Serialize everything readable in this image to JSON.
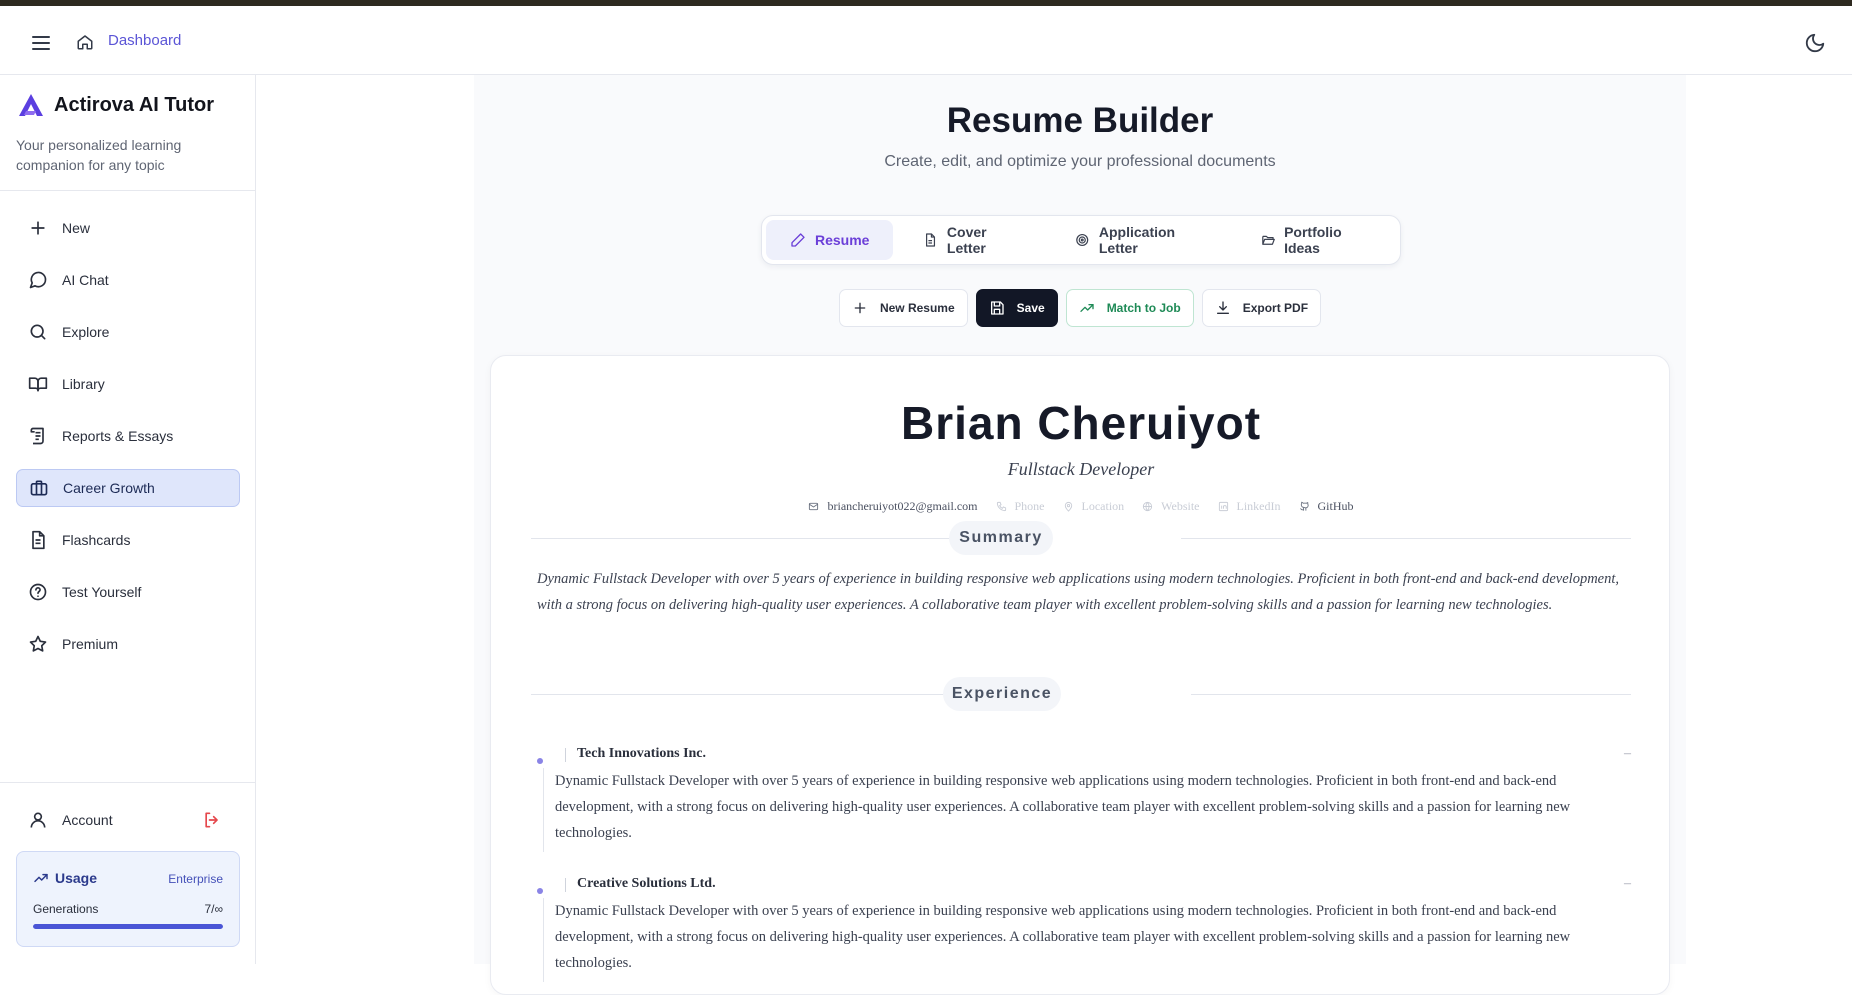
{
  "topbar": {
    "breadcrumb": "Dashboard"
  },
  "brand": {
    "title": "Actirova AI Tutor",
    "subtitle": "Your personalized learning companion for any topic",
    "accent": "#5b3fe0"
  },
  "sidebar": {
    "items": [
      {
        "label": "New",
        "icon": "plus-icon",
        "active": false
      },
      {
        "label": "AI Chat",
        "icon": "chat-bubble-icon",
        "active": false
      },
      {
        "label": "Explore",
        "icon": "search-icon",
        "active": false
      },
      {
        "label": "Library",
        "icon": "open-book-icon",
        "active": false
      },
      {
        "label": "Reports & Essays",
        "icon": "scroll-icon",
        "active": false
      },
      {
        "label": "Career Growth",
        "icon": "briefcase-icon",
        "active": true
      },
      {
        "label": "Flashcards",
        "icon": "document-icon",
        "active": false
      },
      {
        "label": "Test Yourself",
        "icon": "help-circle-icon",
        "active": false
      },
      {
        "label": "Premium",
        "icon": "star-icon",
        "active": false
      }
    ],
    "account_label": "Account"
  },
  "usage": {
    "title": "Usage",
    "plan": "Enterprise",
    "generations_label": "Generations",
    "generations_count": "7/∞",
    "progress_fraction": 1.0
  },
  "page": {
    "title": "Resume Builder",
    "subtitle": "Create, edit, and optimize your professional documents"
  },
  "tabs": [
    {
      "label": "Resume",
      "icon": "pencil-icon",
      "active": true
    },
    {
      "label": "Cover Letter",
      "icon": "file-text-icon",
      "active": false
    },
    {
      "label": "Application Letter",
      "icon": "target-icon",
      "active": false
    },
    {
      "label": "Portfolio Ideas",
      "icon": "folder-open-icon",
      "active": false
    }
  ],
  "actions": {
    "new_resume": "New Resume",
    "save": "Save",
    "match_to_job": "Match to Job",
    "export_pdf": "Export PDF"
  },
  "resume": {
    "name": "Brian Cheruiyot",
    "role": "Fullstack Developer",
    "contacts": {
      "email": "briancheruiyot022@gmail.com",
      "phone": "Phone",
      "location": "Location",
      "website": "Website",
      "linkedin": "LinkedIn",
      "github": "GitHub"
    },
    "summary_heading": "Summary",
    "summary": "Dynamic Fullstack Developer with over 5 years of experience in building responsive web applications using modern technologies. Proficient in both front-end and back-end development, with a strong focus on delivering high-quality user experiences. A collaborative team player with excellent problem-solving skills and a passion for learning new technologies.",
    "experience_heading": "Experience",
    "experience": [
      {
        "company": "Tech Innovations Inc.",
        "dates": "–",
        "description": "Dynamic Fullstack Developer with over 5 years of experience in building responsive web applications using modern technologies. Proficient in both front-end and back-end development, with a strong focus on delivering high-quality user experiences. A collaborative team player with excellent problem-solving skills and a passion for learning new technologies."
      },
      {
        "company": "Creative Solutions Ltd.",
        "dates": "–",
        "description": "Dynamic Fullstack Developer with over 5 years of experience in building responsive web applications using modern technologies. Proficient in both front-end and back-end development, with a strong focus on delivering high-quality user experiences. A collaborative team player with excellent problem-solving skills and a passion for learning new technologies."
      }
    ]
  }
}
